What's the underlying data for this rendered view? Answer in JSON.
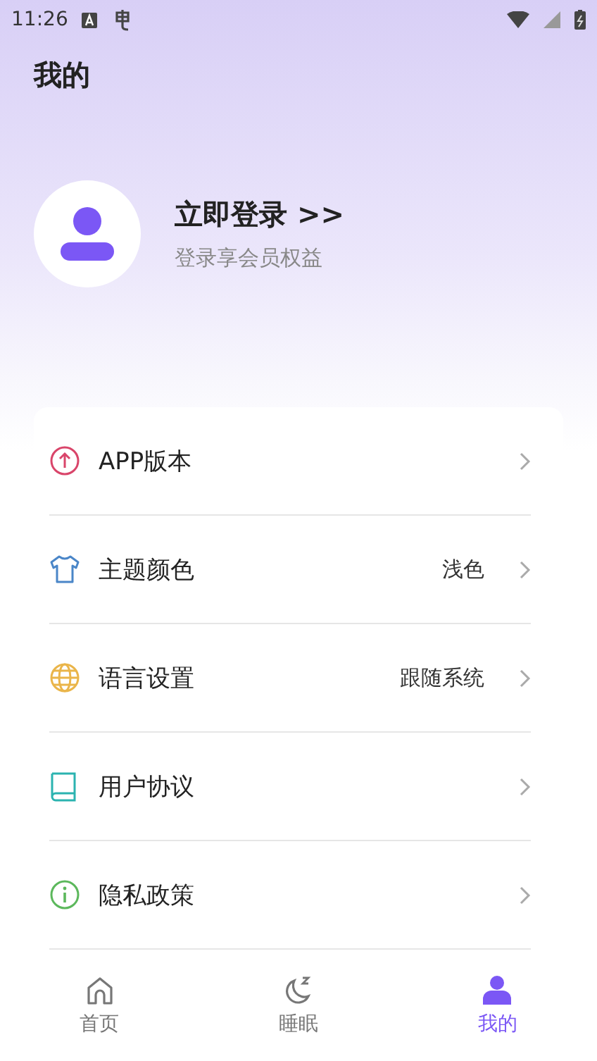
{
  "status_bar": {
    "time": "11:26"
  },
  "header": {
    "title": "我的"
  },
  "profile": {
    "login": "立即登录 >>",
    "subtitle": "登录享会员权益"
  },
  "settings": [
    {
      "kind": "version",
      "label": "APP版本"
    },
    {
      "kind": "theme",
      "label": "主题颜色",
      "value": "浅色"
    },
    {
      "kind": "language",
      "label": "语言设置",
      "value": "跟随系统"
    },
    {
      "kind": "agreement",
      "label": "用户协议"
    },
    {
      "kind": "privacy",
      "label": "隐私政策"
    }
  ],
  "tabs": [
    {
      "kind": "home",
      "label": "首页",
      "selected": false
    },
    {
      "kind": "sleep",
      "label": "睡眠",
      "selected": false
    },
    {
      "kind": "mine",
      "label": "我的",
      "selected": true
    }
  ]
}
